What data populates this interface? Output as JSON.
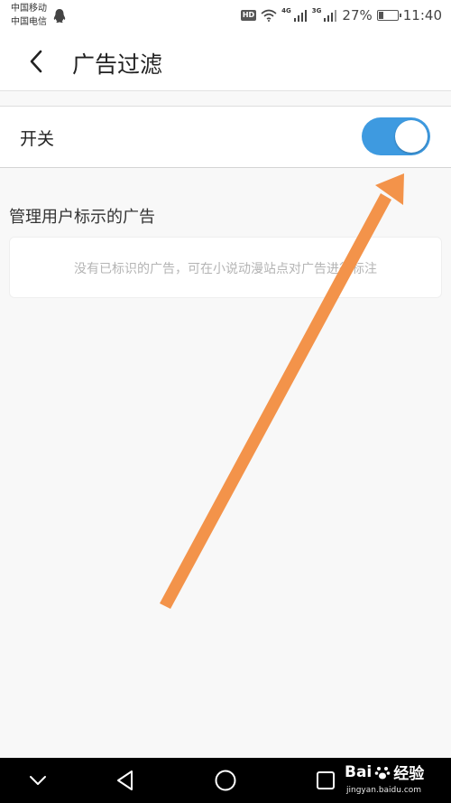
{
  "status_bar": {
    "carrier_1": "中国移动",
    "carrier_2": "中国电信",
    "hd_label": "HD",
    "network_1": "4G",
    "network_2": "3G",
    "battery_percent": "27%",
    "battery_level": 0.27,
    "time": "11:40"
  },
  "header": {
    "back_icon": "chevron-left-icon",
    "title": "广告过滤"
  },
  "toggle": {
    "label": "开关",
    "state": "on",
    "on_color": "#3e9ae0"
  },
  "section": {
    "title": "管理用户标示的广告",
    "empty_message": "没有已标识的广告，可在小说动漫站点对广告进行标注"
  },
  "annotation": {
    "arrow_color": "#f3934a"
  },
  "nav_bar": {
    "icons": [
      "chevron-down-icon",
      "back-triangle-icon",
      "home-circle-icon",
      "recents-square-icon"
    ]
  },
  "watermark": {
    "brand": "Bai",
    "brand_cn": "经验",
    "url": "jingyan.baidu.com"
  }
}
